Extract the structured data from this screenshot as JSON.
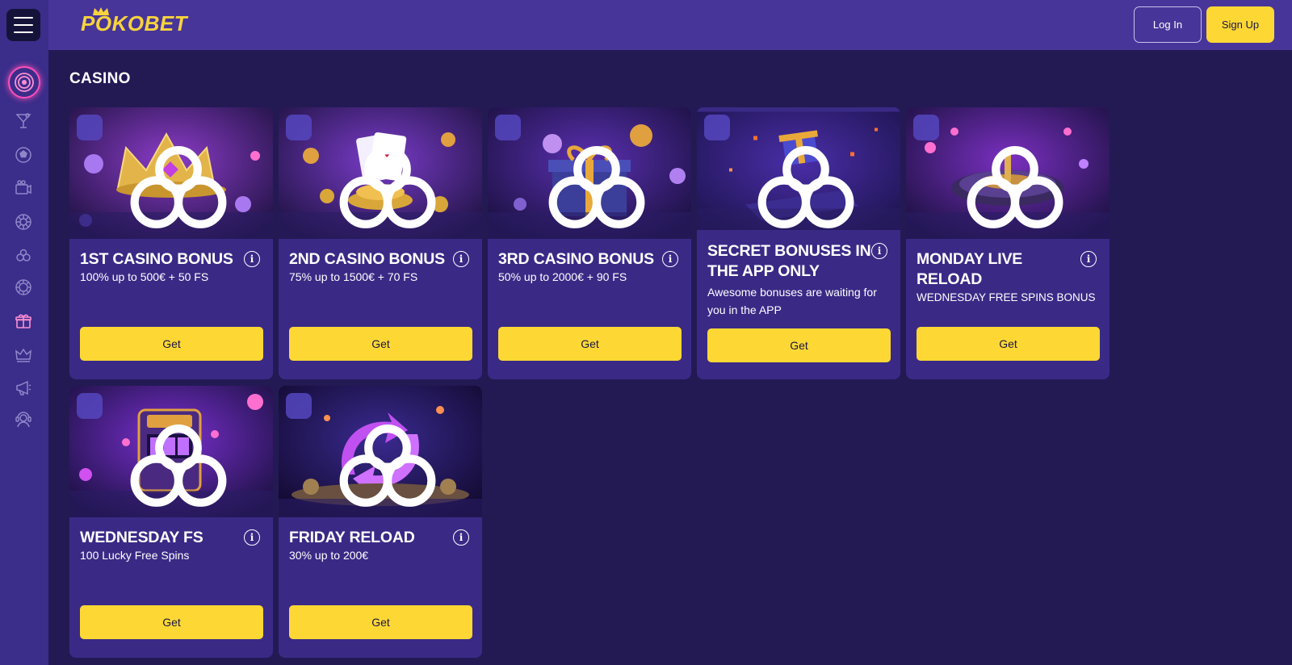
{
  "brand": {
    "logo_text": "POKOBET"
  },
  "header": {
    "login_label": "Log In",
    "signup_label": "Sign Up"
  },
  "sidebar": {
    "items": [
      {
        "icon": "target-icon",
        "active": true
      },
      {
        "icon": "cocktail-icon"
      },
      {
        "icon": "soccer-ball-icon"
      },
      {
        "icon": "live-video-icon"
      },
      {
        "icon": "roulette-wheel-icon"
      },
      {
        "icon": "cherries-icon"
      },
      {
        "icon": "poker-chip-icon"
      },
      {
        "icon": "gift-icon"
      },
      {
        "icon": "crown-icon"
      },
      {
        "icon": "megaphone-icon"
      },
      {
        "icon": "support-agent-icon"
      }
    ]
  },
  "main": {
    "title": "CASINO",
    "bonuses": [
      {
        "title": "1ST CASINO BONUS",
        "subtitle": "100% up to 500€ + 50 FS",
        "button": "Get",
        "image": "crown-image"
      },
      {
        "title": "2ND CASINO BONUS",
        "subtitle": "75% up to 1500€ + 70 FS",
        "button": "Get",
        "image": "cards-coins-image"
      },
      {
        "title": "3RD CASINO BONUS",
        "subtitle": "50% up to 2000€ + 90 FS",
        "button": "Get",
        "image": "gift-box-image"
      },
      {
        "title": "SECRET BONUSES IN THE APP ONLY",
        "subtitle": "Awesome bonuses are waiting for you in the APP",
        "button": "Get",
        "image": "phone-gift-image"
      },
      {
        "title": "MONDAY LIVE RELOAD",
        "subtitle": "WEDNESDAY FREE SPINS BONUS",
        "button": "Get",
        "image": "roulette-image"
      },
      {
        "title": "WEDNESDAY FS",
        "subtitle": "100 Lucky Free Spins",
        "button": "Get",
        "image": "slot-machine-image"
      },
      {
        "title": "FRIDAY RELOAD",
        "subtitle": "30% up to 200€",
        "button": "Get",
        "image": "reload-arrows-image"
      }
    ]
  },
  "colors": {
    "background": "#231a54",
    "header": "#483599",
    "sidebar": "#3b2d8a",
    "card": "#3a2a86",
    "accent_yellow": "#fdd835",
    "active_pink": "#ff4fb8"
  }
}
